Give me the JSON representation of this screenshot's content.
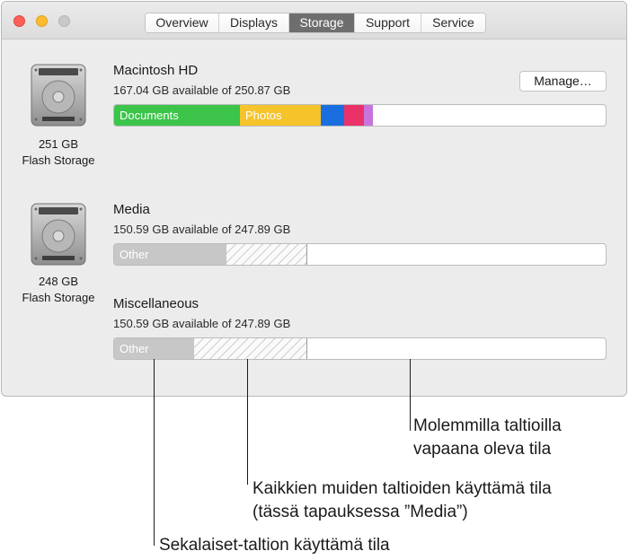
{
  "tabs": [
    {
      "label": "Overview",
      "active": false
    },
    {
      "label": "Displays",
      "active": false
    },
    {
      "label": "Storage",
      "active": true
    },
    {
      "label": "Support",
      "active": false
    },
    {
      "label": "Service",
      "active": false
    }
  ],
  "drives": [
    {
      "size": "251 GB",
      "type": "Flash Storage"
    },
    {
      "size": "248 GB",
      "type": "Flash Storage"
    }
  ],
  "volumes": {
    "macintosh": {
      "name": "Macintosh HD",
      "available": "167.04 GB available of 250.87 GB",
      "manage_label": "Manage…",
      "segments": [
        {
          "label": "Documents",
          "color": "#3cc44b"
        },
        {
          "label": "Photos",
          "color": "#f5c32a"
        },
        {
          "label": "",
          "color": "#1a6fe0"
        },
        {
          "label": "",
          "color": "#ea3268"
        },
        {
          "label": "",
          "color": "#c774dc"
        }
      ]
    },
    "media": {
      "name": "Media",
      "available": "150.59 GB available of 247.89 GB",
      "other_label": "Other",
      "other_color": "#c7c7c7"
    },
    "misc": {
      "name": "Miscellaneous",
      "available": "150.59 GB available of 247.89 GB",
      "other_label": "Other",
      "other_color": "#c7c7c7"
    }
  },
  "callouts": {
    "free_line1": "Molemmilla taltioilla",
    "free_line2": "vapaana oleva tila",
    "others_line1": "Kaikkien muiden taltioiden käyttämä tila",
    "others_line2": "(tässä tapauksessa ”Media”)",
    "misc_used": "Sekalaiset-taltion käyttämä tila"
  }
}
